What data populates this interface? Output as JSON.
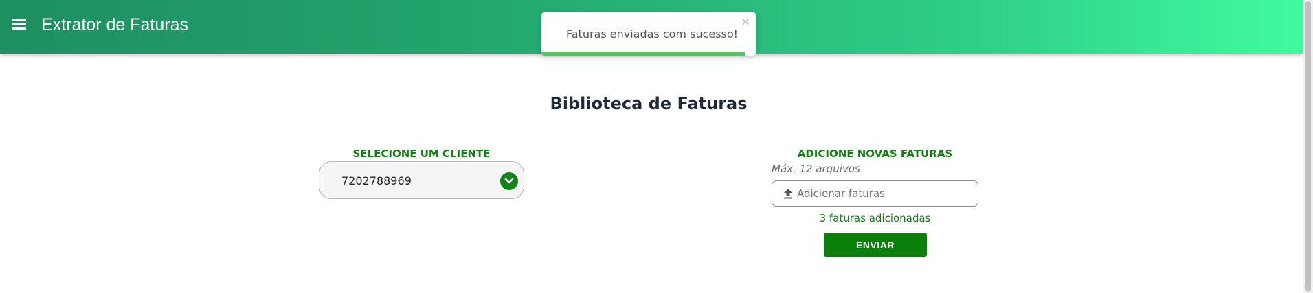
{
  "app_bar": {
    "title": "Extrator de Faturas",
    "menu_icon": "hamburger-menu-icon"
  },
  "toast": {
    "message": "Faturas enviadas com sucesso!",
    "close_symbol": "×",
    "progress": 0.95,
    "progress_color": "#58c461"
  },
  "main": {
    "heading": "Biblioteca de Faturas"
  },
  "client_section": {
    "label": "SELECIONE UM CLIENTE",
    "selected_value": "7202788969",
    "dropdown_icon": "chevron-down-icon"
  },
  "invoices_section": {
    "label": "ADICIONE NOVAS FATURAS",
    "max_files": "Máx. 12 arquivos",
    "input_placeholder": "Adicionar faturas",
    "upload_icon": "upload-icon",
    "added_count_text": "3 faturas adicionadas",
    "send_label": "ENVIAR"
  },
  "colors": {
    "accent_green": "#138013",
    "button_green": "#0a800a",
    "header_gradient_start": "#1e8f60",
    "header_gradient_end": "#40fba0"
  }
}
